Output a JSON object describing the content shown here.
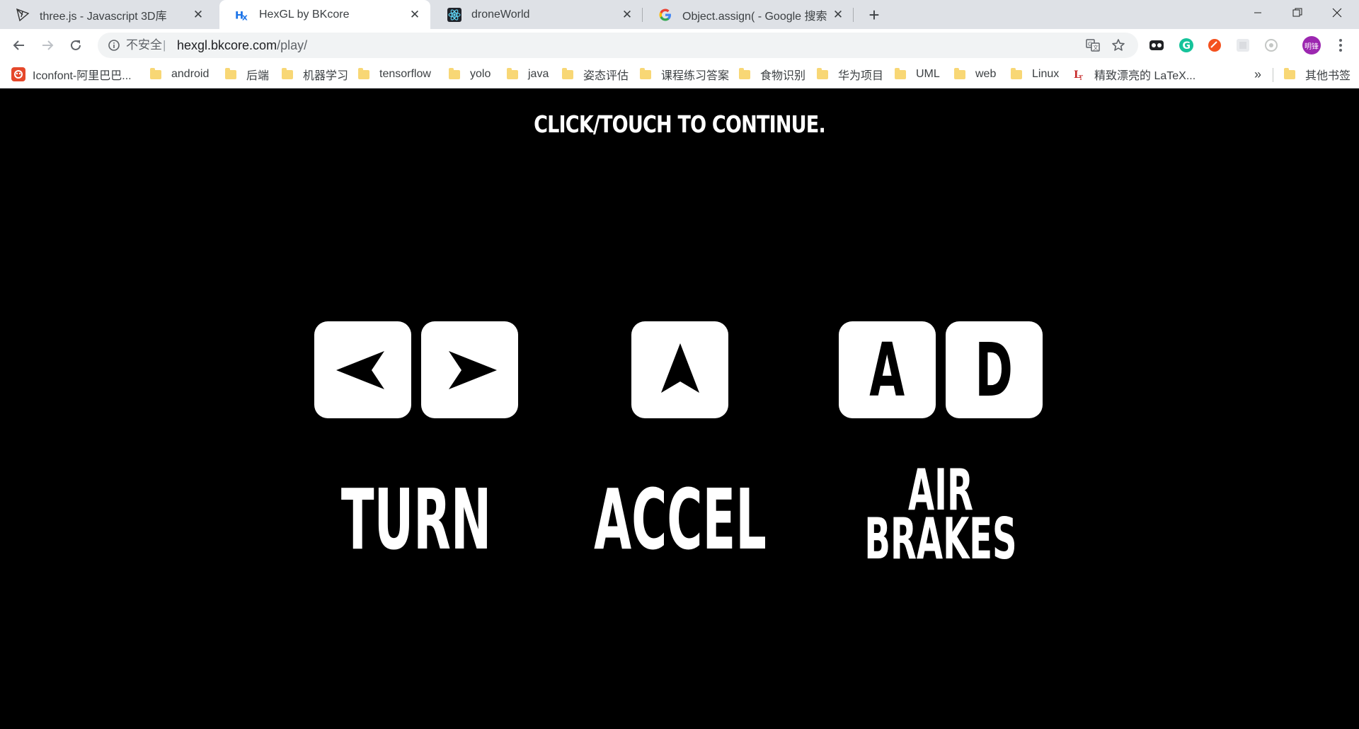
{
  "browser": {
    "tabs": [
      {
        "title": "three.js - Javascript 3D库",
        "icon": "threejs-icon",
        "active": false
      },
      {
        "title": "HexGL by BKcore",
        "icon": "hexgl-icon",
        "active": true
      },
      {
        "title": "droneWorld",
        "icon": "react-icon",
        "active": false
      },
      {
        "title": "Object.assign( - Google 搜索",
        "icon": "google-icon",
        "active": false
      }
    ],
    "address_bar": {
      "security_label": "不安全",
      "separator": "|",
      "url_host": "hexgl.bkcore.com",
      "url_path": "/play/"
    },
    "profile_initials": "明锋",
    "bookmarks": [
      {
        "label": "Iconfont-阿里巴巴...",
        "icon": "iconfont-icon"
      },
      {
        "label": "android",
        "icon": "folder-icon"
      },
      {
        "label": "后端",
        "icon": "folder-icon"
      },
      {
        "label": "机器学习",
        "icon": "folder-icon"
      },
      {
        "label": "tensorflow",
        "icon": "folder-icon"
      },
      {
        "label": "yolo",
        "icon": "folder-icon"
      },
      {
        "label": "java",
        "icon": "folder-icon"
      },
      {
        "label": "姿态评估",
        "icon": "folder-icon"
      },
      {
        "label": "课程练习答案",
        "icon": "folder-icon"
      },
      {
        "label": "食物识别",
        "icon": "folder-icon"
      },
      {
        "label": "华为项目",
        "icon": "folder-icon"
      },
      {
        "label": "UML",
        "icon": "folder-icon"
      },
      {
        "label": "web",
        "icon": "folder-icon"
      },
      {
        "label": "Linux",
        "icon": "folder-icon"
      },
      {
        "label": "精致漂亮的 LaTeX...",
        "icon": "latex-icon"
      }
    ],
    "bookmarks_overflow": "»",
    "other_bookmarks": "其他书签"
  },
  "game": {
    "prompt": "CLICK/TOUCH TO CONTINUE.",
    "keys": {
      "a": "A",
      "d": "D"
    },
    "labels": {
      "turn": "TURN",
      "accel": "ACCEL",
      "air": "AIR",
      "brakes": "BRAKES"
    }
  },
  "colors": {
    "tab_strip": "#dee1e6",
    "background": "#000000",
    "key": "#ffffff",
    "text": "#ffffff",
    "profile": "#9c27b0"
  }
}
